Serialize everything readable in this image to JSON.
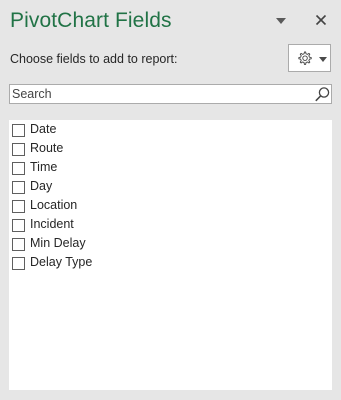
{
  "header": {
    "title": "PivotChart Fields",
    "subtitle": "Choose fields to add to report:",
    "pane_options_icon": "chevron-down-icon",
    "close_icon": "close-icon",
    "tools_icon": "gear-icon"
  },
  "search": {
    "placeholder": "Search",
    "value": "",
    "icon": "search-icon"
  },
  "fields": [
    {
      "label": "Date",
      "checked": false
    },
    {
      "label": "Route",
      "checked": false
    },
    {
      "label": "Time",
      "checked": false
    },
    {
      "label": "Day",
      "checked": false
    },
    {
      "label": "Location",
      "checked": false
    },
    {
      "label": "Incident",
      "checked": false
    },
    {
      "label": "Min Delay",
      "checked": false
    },
    {
      "label": "Delay Type",
      "checked": false
    }
  ],
  "colors": {
    "title": "#217346",
    "background": "#e6e6e6",
    "panel": "#ffffff",
    "border": "#ababab"
  }
}
